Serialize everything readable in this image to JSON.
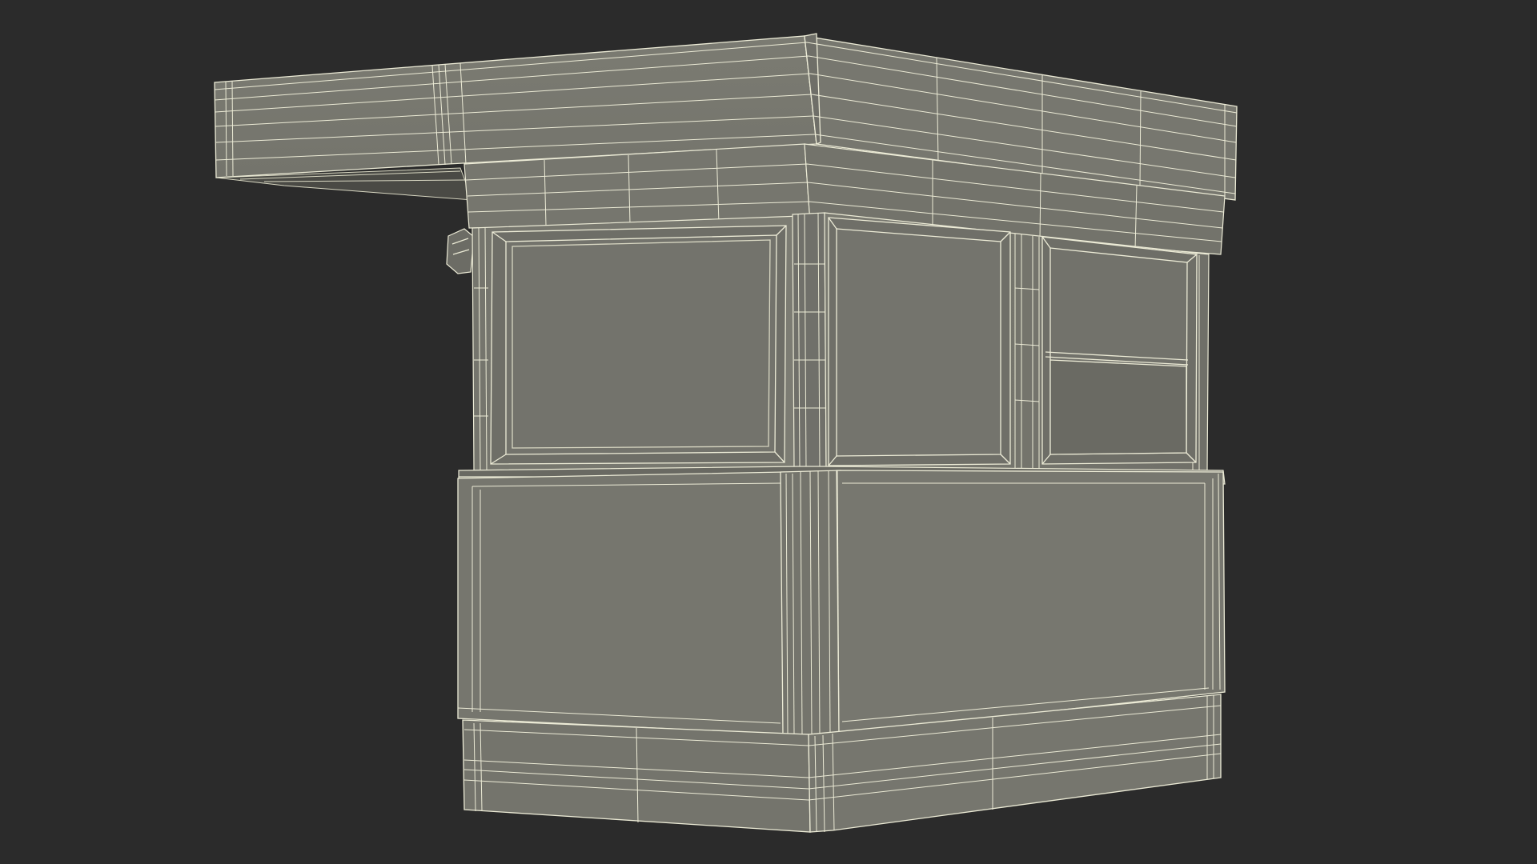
{
  "scene": {
    "subject": "kiosk-wireframe-render",
    "colors": {
      "background": "#2b2b2b",
      "surface_light": "#7a7a70",
      "surface_mid": "#71716a",
      "surface_dark": "#5f5f58",
      "underside": "#4d4d47",
      "wire": "#ecebd6",
      "wire_faint": "#d8d7c2"
    }
  }
}
